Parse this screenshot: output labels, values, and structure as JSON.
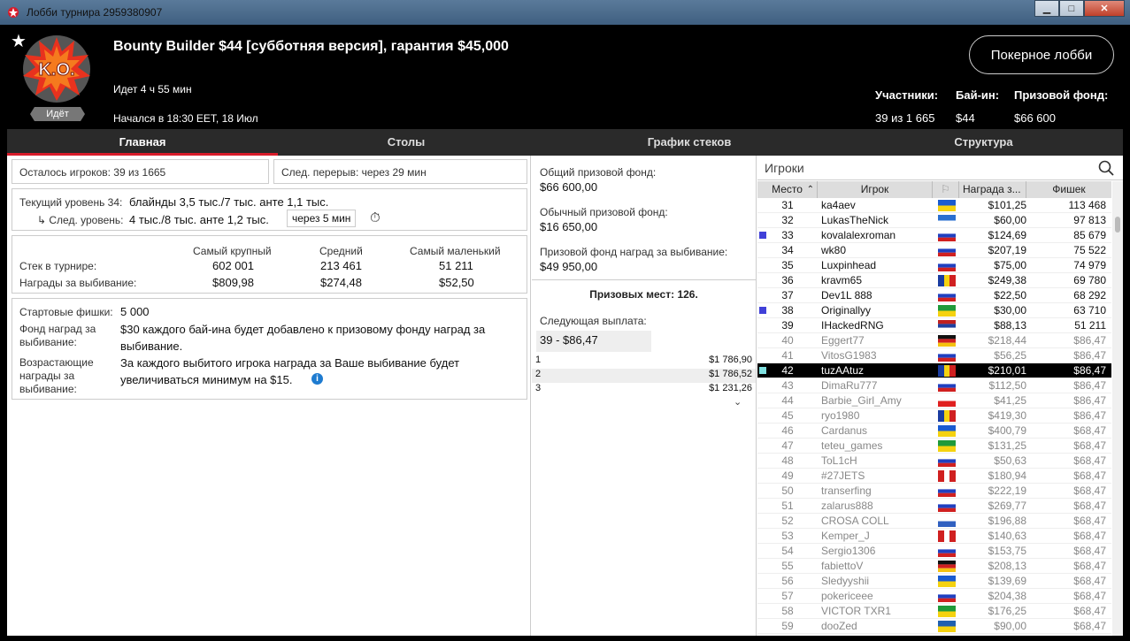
{
  "window": {
    "title": "Лобби турнира 2959380907",
    "btn_min": "▁",
    "btn_max": "□",
    "btn_close": "✕"
  },
  "header": {
    "tournament_name": "Bounty Builder $44 [субботняя версия], гарантия $45,000",
    "running_for": "Идет 4 ч 55 мин",
    "started": "Начался в 18:30 EET, 18 Июл",
    "status": "Идёт",
    "logo_text": "K.O.",
    "lobby_button": "Покерное лобби",
    "participants_label": "Участники:",
    "participants_value": "39 из 1 665",
    "buyin_label": "Бай-ин:",
    "buyin_value": "$44",
    "prizepool_label": "Призовой фонд:",
    "prizepool_value": "$66 600"
  },
  "tabs": [
    "Главная",
    "Столы",
    "График стеков",
    "Структура"
  ],
  "main": {
    "players_left": "Осталось игроков: 39 из 1665",
    "next_break": "След. перерыв: через 29 мин",
    "current_level_label": "Текущий уровень 34:",
    "current_level_value": "блайнды 3,5 тыс./7 тыс. анте 1,1 тыс.",
    "next_level_label": "↳ След. уровень:",
    "next_level_value": "4 тыс./8 тыс. анте 1,2 тыс.",
    "next_level_in": "через 5 мин",
    "stats_headers": [
      "Самый крупный",
      "Средний",
      "Самый маленький"
    ],
    "stack_label": "Стек в турнире:",
    "stack_values": [
      "602 001",
      "213 461",
      "51 211"
    ],
    "bounty_label": "Награды за выбивание:",
    "bounty_values": [
      "$809,98",
      "$274,48",
      "$52,50"
    ],
    "start_chips_label": "Стартовые фишки:",
    "start_chips_value": "5 000",
    "bounty_fund_label": "Фонд наград за выбивание:",
    "bounty_fund_value": "$30 каждого бай-ина будет добавлено к призовому фонду наград за выбивание.",
    "progressive_label": "Возрастающие награды за выбивание:",
    "progressive_value": "За каждого выбитого игрока награда за Ваше выбивание будет увеличиваться минимум на $15."
  },
  "prizes": {
    "total_label": "Общий призовой фонд:",
    "total_value": "$66 600,00",
    "regular_label": "Обычный призовой фонд:",
    "regular_value": "$16 650,00",
    "bounty_label": "Призовой фонд наград за выбивание:",
    "bounty_value": "$49 950,00",
    "paid_places": "Призовых мест: 126.",
    "next_payout_label": "Следующая выплата:",
    "next_payout_value": "39 - $86,47",
    "payouts": [
      {
        "place": "1",
        "amount": "$1 786,90"
      },
      {
        "place": "2",
        "amount": "$1 786,52"
      },
      {
        "place": "3",
        "amount": "$1 231,26"
      }
    ]
  },
  "players": {
    "title": "Игроки",
    "columns": {
      "place": "Место",
      "player": "Игрок",
      "prize": "Награда з...",
      "chips": "Фишек"
    },
    "rows": [
      {
        "place": "31",
        "name": "ka4aev",
        "flag": "ua",
        "prize": "$101,25",
        "chips": "113 468",
        "mark": "",
        "grey": false
      },
      {
        "place": "32",
        "name": "LukasTheNick",
        "flag": "gr",
        "prize": "$60,00",
        "chips": "97 813",
        "mark": "",
        "grey": false
      },
      {
        "place": "33",
        "name": "kovalalexroman",
        "flag": "ru",
        "prize": "$124,69",
        "chips": "85 679",
        "mark": "blue",
        "grey": false
      },
      {
        "place": "34",
        "name": "wk80",
        "flag": "ru",
        "prize": "$207,19",
        "chips": "75 522",
        "mark": "",
        "grey": false
      },
      {
        "place": "35",
        "name": "Luxpinhead",
        "flag": "ru",
        "prize": "$75,00",
        "chips": "74 979",
        "mark": "",
        "grey": false
      },
      {
        "place": "36",
        "name": "kravm65",
        "flag": "ro",
        "prize": "$249,38",
        "chips": "69 780",
        "mark": "",
        "grey": false
      },
      {
        "place": "37",
        "name": "Dev1L 888",
        "flag": "ru",
        "prize": "$22,50",
        "chips": "68 292",
        "mark": "",
        "grey": false
      },
      {
        "place": "38",
        "name": "Originallyy",
        "flag": "br",
        "prize": "$30,00",
        "chips": "63 710",
        "mark": "blue",
        "grey": false
      },
      {
        "place": "39",
        "name": "IHackedRNG",
        "flag": "rs",
        "prize": "$88,13",
        "chips": "51 211",
        "mark": "",
        "grey": false
      },
      {
        "place": "40",
        "name": "Eggert77",
        "flag": "de",
        "prize": "$218,44",
        "chips": "$86,47",
        "mark": "",
        "grey": true
      },
      {
        "place": "41",
        "name": "VitosG1983",
        "flag": "ru",
        "prize": "$56,25",
        "chips": "$86,47",
        "mark": "",
        "grey": true
      },
      {
        "place": "42",
        "name": "tuzAAtuz",
        "flag": "md",
        "prize": "$210,01",
        "chips": "$86,47",
        "mark": "cyan",
        "grey": false,
        "selected": true
      },
      {
        "place": "43",
        "name": "DimaRu777",
        "flag": "ru",
        "prize": "$112,50",
        "chips": "$86,47",
        "mark": "",
        "grey": true
      },
      {
        "place": "44",
        "name": "Barbie_Girl_Amy",
        "flag": "ge",
        "prize": "$41,25",
        "chips": "$86,47",
        "mark": "",
        "grey": true
      },
      {
        "place": "45",
        "name": "ryo1980",
        "flag": "ro",
        "prize": "$419,30",
        "chips": "$86,47",
        "mark": "",
        "grey": true
      },
      {
        "place": "46",
        "name": "Cardanus",
        "flag": "ua",
        "prize": "$400,79",
        "chips": "$68,47",
        "mark": "",
        "grey": true
      },
      {
        "place": "47",
        "name": "teteu_games",
        "flag": "br",
        "prize": "$131,25",
        "chips": "$68,47",
        "mark": "",
        "grey": true
      },
      {
        "place": "48",
        "name": "ToL1cH",
        "flag": "ru",
        "prize": "$50,63",
        "chips": "$68,47",
        "mark": "",
        "grey": true
      },
      {
        "place": "49",
        "name": "#27JETS",
        "flag": "ca",
        "prize": "$180,94",
        "chips": "$68,47",
        "mark": "",
        "grey": true
      },
      {
        "place": "50",
        "name": "transerfing",
        "flag": "ru",
        "prize": "$222,19",
        "chips": "$68,47",
        "mark": "",
        "grey": true
      },
      {
        "place": "51",
        "name": "zalarus888",
        "flag": "ru",
        "prize": "$269,77",
        "chips": "$68,47",
        "mark": "",
        "grey": true
      },
      {
        "place": "52",
        "name": "CROSA COLL",
        "flag": "uy",
        "prize": "$196,88",
        "chips": "$68,47",
        "mark": "",
        "grey": true
      },
      {
        "place": "53",
        "name": "Kemper_J",
        "flag": "ca",
        "prize": "$140,63",
        "chips": "$68,47",
        "mark": "",
        "grey": true
      },
      {
        "place": "54",
        "name": "Sergio1306",
        "flag": "ru",
        "prize": "$153,75",
        "chips": "$68,47",
        "mark": "",
        "grey": true
      },
      {
        "place": "55",
        "name": "fabiettoV",
        "flag": "de",
        "prize": "$208,13",
        "chips": "$68,47",
        "mark": "",
        "grey": true
      },
      {
        "place": "56",
        "name": "Sledyyshii",
        "flag": "ua",
        "prize": "$139,69",
        "chips": "$68,47",
        "mark": "",
        "grey": true
      },
      {
        "place": "57",
        "name": "pokericeee",
        "flag": "ru",
        "prize": "$204,38",
        "chips": "$68,47",
        "mark": "",
        "grey": true
      },
      {
        "place": "58",
        "name": "VICTOR TXR1",
        "flag": "br",
        "prize": "$176,25",
        "chips": "$68,47",
        "mark": "",
        "grey": true
      },
      {
        "place": "59",
        "name": "dooZed",
        "flag": "se",
        "prize": "$90,00",
        "chips": "$68,47",
        "mark": "",
        "grey": true
      }
    ]
  },
  "colors": {
    "accent_red": "#d81c2a",
    "mark_blue": "#4040d8",
    "mark_cyan": "#7fe0e0"
  }
}
